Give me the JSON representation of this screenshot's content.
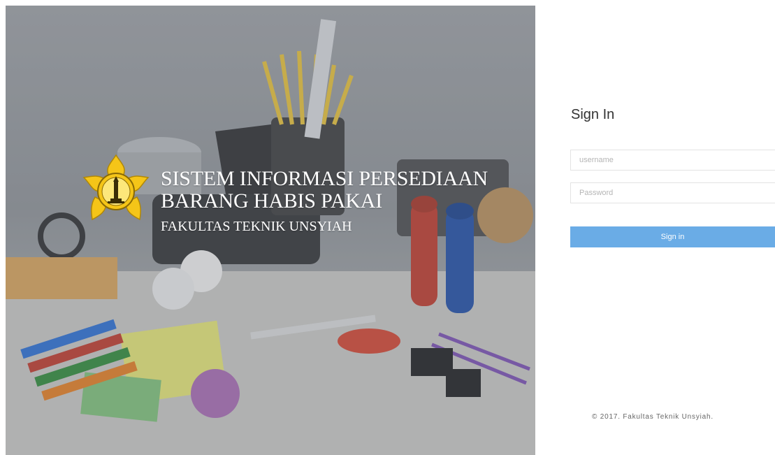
{
  "hero": {
    "title_line1": "SISTEM INFORMASI PERSEDIAAN",
    "title_line2": "BARANG HABIS PAKAI",
    "subtitle": "FAKULTAS TEKNIK UNSYIAH",
    "logo_icon": "university-emblem-icon",
    "background_image": "office-supplies-photo"
  },
  "login": {
    "title": "Sign In",
    "username_placeholder": "username",
    "username_value": "",
    "password_placeholder": "Password",
    "password_value": "",
    "submit_label": "Sign in"
  },
  "footer": {
    "copyright": "© 2017. Fakultas Teknik Unsyiah."
  },
  "colors": {
    "button": "#6aace6",
    "hero_overlay": "#6e727a",
    "logo_yellow": "#f5c518"
  }
}
